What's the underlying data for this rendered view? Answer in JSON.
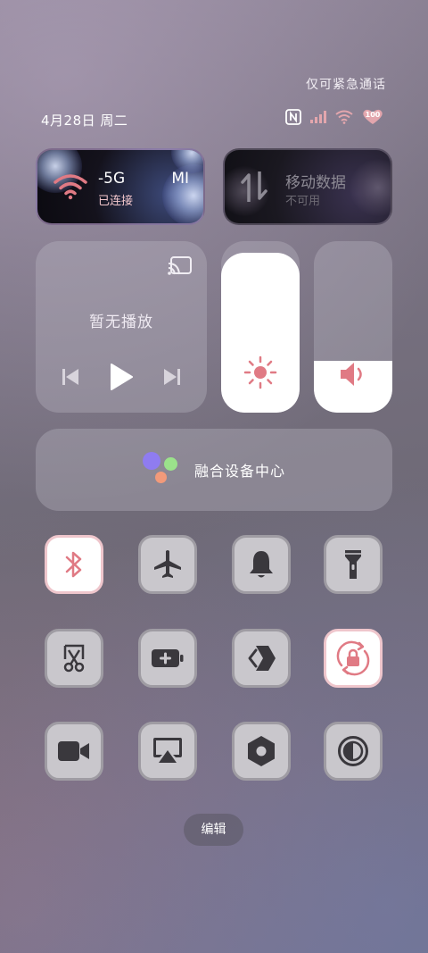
{
  "status_bar": {
    "emergency_text": "仅可紧急通话",
    "date_text": "4月28日 周二",
    "battery_level": "100"
  },
  "wifi_tile": {
    "title": "-5G",
    "title_suffix": "MI",
    "status": "已连接"
  },
  "data_tile": {
    "title": "移动数据",
    "status": "不可用"
  },
  "media": {
    "title": "暂无播放"
  },
  "sliders": {
    "brightness_level": 0.93,
    "volume_level": 0.3
  },
  "fusion": {
    "label": "融合设备中心"
  },
  "toggles": [
    {
      "name": "bluetooth",
      "on": true
    },
    {
      "name": "airplane-mode",
      "on": false
    },
    {
      "name": "ring-mode",
      "on": false
    },
    {
      "name": "flashlight",
      "on": false
    },
    {
      "name": "screenshot",
      "on": false
    },
    {
      "name": "battery-saver",
      "on": false
    },
    {
      "name": "share",
      "on": false
    },
    {
      "name": "rotation-lock",
      "on": true
    },
    {
      "name": "screen-record",
      "on": false
    },
    {
      "name": "screen-cast",
      "on": false
    },
    {
      "name": "settings",
      "on": false
    },
    {
      "name": "dark-mode",
      "on": false
    }
  ],
  "colors": {
    "accent": "#e07a84",
    "toggle_icon": "#3a383d"
  },
  "edit_label": "编辑"
}
